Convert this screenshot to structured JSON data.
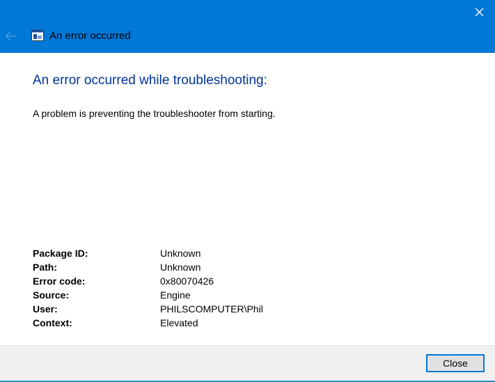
{
  "window": {
    "title": "An error occurred",
    "accent_color": "#0078d7",
    "heading_color": "#003399"
  },
  "main": {
    "heading": "An error occurred while troubleshooting:",
    "message": "A problem is preventing the troubleshooter from starting."
  },
  "details": [
    {
      "label": "Package ID:",
      "value": "Unknown"
    },
    {
      "label": "Path:",
      "value": "Unknown"
    },
    {
      "label": "Error code:",
      "value": "0x80070426"
    },
    {
      "label": "Source:",
      "value": "Engine"
    },
    {
      "label": "User:",
      "value": "PHILSCOMPUTER\\Phil"
    },
    {
      "label": "Context:",
      "value": "Elevated"
    }
  ],
  "footer": {
    "close_label": "Close"
  }
}
